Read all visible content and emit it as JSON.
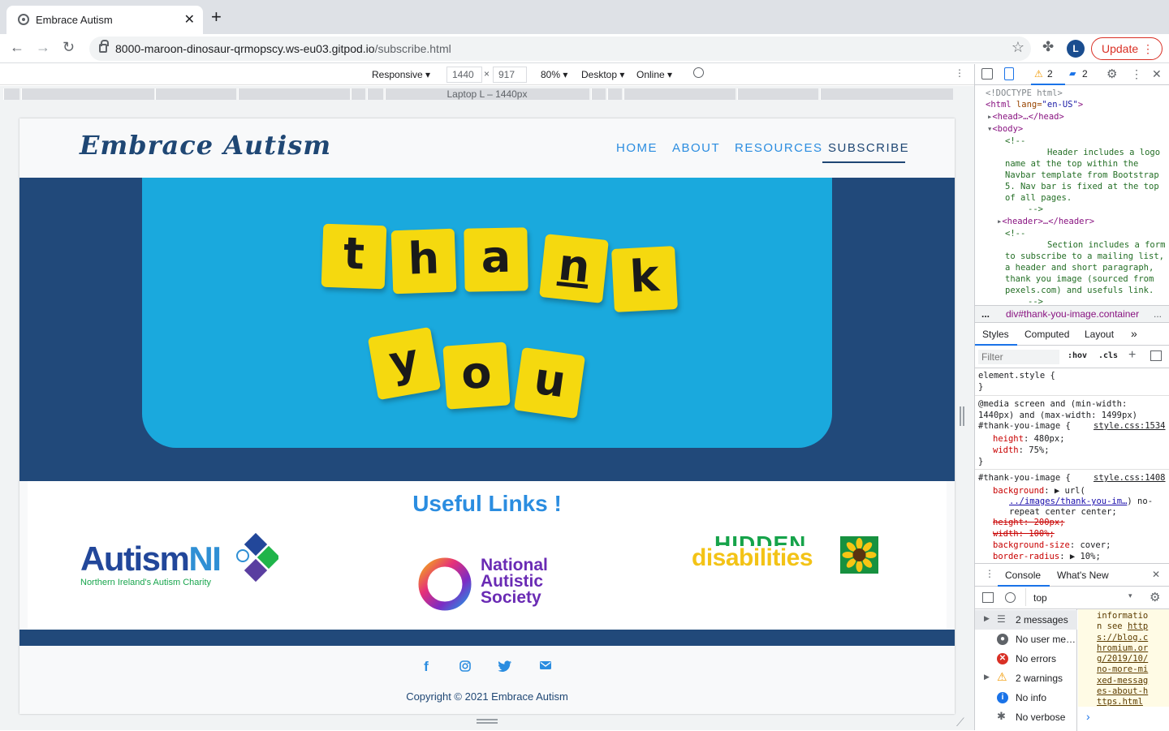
{
  "browser": {
    "tab_title": "Embrace Autism",
    "url_host": "8000-maroon-dinosaur-qrmopscy.ws-eu03.gitpod.io",
    "url_path": "/subscribe.html",
    "update_label": "Update",
    "avatar_letter": "L"
  },
  "device_toolbar": {
    "mode": "Responsive ▾",
    "width": "1440",
    "height": "917",
    "zoom": "80% ▾",
    "device_type": "Desktop ▾",
    "throttle": "Online ▾",
    "media_label": "Laptop L – 1440px"
  },
  "site": {
    "logo": "Embrace Autism",
    "nav": [
      "HOME",
      "ABOUT",
      "RESOURCES",
      "SUBSCRIBE"
    ],
    "hero_tiles_row1": [
      "t",
      "h",
      "a",
      "n",
      "k"
    ],
    "hero_tiles_row2": [
      "y",
      "o",
      "u"
    ],
    "links_title": "Useful Links !",
    "autism_ni": {
      "name_a": "Autism",
      "name_b": "NI",
      "tagline": "Northern Ireland's Autism Charity"
    },
    "nas": {
      "line1": "National",
      "line2": "Autistic",
      "line3": "Society"
    },
    "hidden": {
      "line1": "HIDDEN",
      "line2": "disabilities"
    },
    "copyright": "Copyright © 2021 Embrace Autism",
    "social_icons": [
      "facebook-icon",
      "instagram-icon",
      "twitter-icon",
      "envelope-icon"
    ]
  },
  "devtools": {
    "warnings_count": "2",
    "messages_count": "2",
    "elements": {
      "doctype": "<!DOCTYPE html>",
      "html_open": "<html",
      "html_attr": " lang=",
      "html_val": "\"en-US\"",
      "html_close": ">",
      "head": "<head>…</head>",
      "body": "<body>",
      "comment_open": "<!--",
      "comment1": [
        "Header includes a logo",
        "name at the top within the",
        "Navbar template from Bootstrap",
        "5. Nav bar is fixed at the top",
        "of all pages."
      ],
      "comment_close": "-->",
      "header": "<header>…</header>",
      "comment2": [
        "Section includes a form",
        "to subscribe to a mailing list,",
        "a header and short paragraph,",
        "thank you image (sourced from",
        "pexels.com) and usefuls link."
      ]
    },
    "breadcrumb_dots": "...",
    "breadcrumb": "div#thank-you-image.container",
    "breadcrumb_more": "...",
    "tabs": [
      "Styles",
      "Computed",
      "Layout",
      "»"
    ],
    "filter_placeholder": "Filter",
    "hov": ":hov",
    "cls": ".cls",
    "styles": {
      "element_style": "element.style {",
      "close_brace": "}",
      "media_rule_1": "@media screen and (min-width:",
      "media_rule_2": "1440px) and (max-width: 1499px)",
      "selector": "#thank-you-image {",
      "src1": "style.css:1534",
      "height_prop": "height",
      "height_val": ": 480px;",
      "width_prop": "width",
      "width_val": ": 75%;",
      "src2": "style.css:1408",
      "bg_prop": "background",
      "bg_val": ": ▶ url(",
      "bg_url": "../images/thank-you-im…",
      "bg_val2": ") no-",
      "bg_val3": "repeat center center;",
      "struck_height": "height: 200px;",
      "struck_width": "width: 100%;",
      "bgsize_prop": "background-size",
      "bgsize_val": ": cover;",
      "radius_prop": "border-radius",
      "radius_val": ": ▶ 10%;"
    },
    "drawer_tabs": [
      "Console",
      "What's New"
    ],
    "context": "top",
    "console_side": [
      {
        "label": "2 messages",
        "icon": "list-icon"
      },
      {
        "label": "No user me…",
        "icon": "user-icon"
      },
      {
        "label": "No errors",
        "icon": "error-icon"
      },
      {
        "label": "2 warnings",
        "icon": "warning-icon"
      },
      {
        "label": "No info",
        "icon": "info-icon"
      },
      {
        "label": "No verbose",
        "icon": "verbose-icon"
      }
    ],
    "console_message_plain": "informatio n see ",
    "console_message_link": "https://blog.chromium.org/2019/10/no-more-mixed-messages-about-https.html",
    "prompt": "›"
  }
}
